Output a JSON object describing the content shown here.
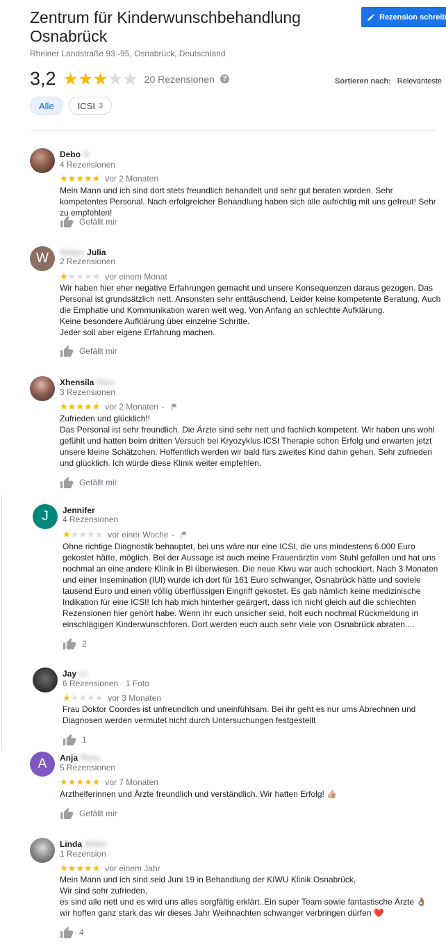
{
  "header": {
    "title": "Zentrum für Kinderwunschbehandlung Osnabrück",
    "address": "Rheiner Landstraße 93 -95, Osnabrück, Deutschland",
    "write_review_label": "Rezension schreiben",
    "rating": "3,2",
    "rating_value": 3.2,
    "review_count": "20 Rezensionen",
    "sort_label": "Sortieren nach:",
    "sort_value": "Relevanteste"
  },
  "filters": [
    {
      "label": "Alle",
      "count": ""
    },
    {
      "label": "ICSI",
      "count": "3"
    }
  ],
  "colors": {
    "accent": "#1a73e8",
    "star": "#fbbc04",
    "avatar_w": "#8d6e63",
    "avatar_j": "#00897b",
    "avatar_a": "#7e57c2"
  },
  "reviews": [
    {
      "name": "Debo",
      "name_blurred": "S",
      "meta": "4 Rezensionen",
      "stars": 5,
      "time": "vor 2 Monaten",
      "text": "Mein Mann und ich sind dort stets freundlich behandelt und sehr gut beraten worden. Sehr kompetentes Personal. Nach erfolgreicher Behandlung haben sich alle aufrichtig mit uns gefreut! Sehr zu empfehlen!",
      "like": "Gefällt mir"
    },
    {
      "name": "Julia",
      "name_blurred": "Weber",
      "initial": "W",
      "meta": "2 Rezensionen",
      "stars": 1,
      "time": "vor einem Monat",
      "text": "Wir haben hier eher negative Erfahrungen gemacht und unsere Konsequenzen daraus gezogen. Das Personal ist grundsätzlich nett. Ansonsten sehr enttäuschend.  Leider keine kompetente Beratung. Auch die Emphatie und Kommunikation waren weit weg. Von Anfang an schlechte Aufklärung.\nKeine besondere Aufklärung über einzelne Schritte.\nJeder soll aber eigene Erfahrung machen.",
      "like": "Gefällt mir"
    },
    {
      "name": "Xhensila",
      "name_blurred": "Peru",
      "meta": "3 Rezensionen",
      "stars": 5,
      "time": "vor 2 Monaten",
      "text": "Zufrieden und glücklich!!\nDas Personal ist sehr freundlich. Die Ärzte sind sehr nett und fachlich kompetent. Wir haben uns wohl gefühlt und hatten beim dritten Versuch bei Kryozyklus ICSI Therapie schon Erfolg und erwarten jetzt unsere kleine Schätzchen. Hoffentlich werden wir bald fürs zweites Kind dahin gehen. Sehr zufrieden und glücklich. Ich würde diese Klinik weiter empfehlen.",
      "like": "Gefällt mir"
    },
    {
      "name": "Jennifer",
      "initial": "J",
      "meta": "4 Rezensionen",
      "stars": 1,
      "time": "vor einer Woche",
      "text": "Ohne richtige Diagnostik behauptet,  bei uns wäre nur eine ICSI, die uns mindestens 6.000 Euro gekostet hätte, möglich. Bei der Aussage ist auch meine Frauenärztin vom Stuhl gefallen und hat uns nochmal an eine andere Klinik in Bl überwiesen. Die neue Kiwu war auch schockiert. Nach 3 Monaten und einer Insemination (IUI) wurde ich dort für 161 Euro schwanger, Osnabrück hätte und soviele tausend Euro und einen völlig überflüssigen Eingriff gekostet. Es gab nämlich  keine medizinische Indikation für eine ICSI! Ich hab mich hinterher geärgert,  dass ich nicht gleich auf die schlechten Rezensionen hier gehört habe. Wenn ihr euch unsicher seid, holt euch nochmal Rückmeldung in einschlägigen Kinderwunschforen. Dort werden euch auch sehr viele von Osnabrück abraten....",
      "like": "2"
    },
    {
      "name": "Jay",
      "name_blurred": "Ci",
      "meta": "6 Rezensionen · 1 Foto",
      "stars": 1,
      "time": "vor 3 Monaten",
      "text": "Frau Doktor Coordes ist unfreundlich und uneinfühlsam. Bei ihr geht es nur ums Abrechnen und Diagnosen werden vermutet nicht durch Untersuchungen festgestellt",
      "like": "1"
    },
    {
      "name": "Anja",
      "name_blurred": "Renz",
      "initial": "A",
      "meta": "5 Rezensionen",
      "stars": 5,
      "time": "vor 7 Monaten",
      "text": "Arzthelferinnen und Ärzte freundlich und verständlich. Wir hatten Erfolg!",
      "emoji": "👍🏼",
      "like": "Gefällt mir"
    },
    {
      "name": "Linda",
      "name_blurred": "Müller",
      "meta": "1 Rezension",
      "stars": 5,
      "time": "vor einem Jahr",
      "text": "Mein Mann und ich sind seid Juni 19 in Behandlung der KIWU Klinik Osnabrück,\nWir sind sehr zufrieden,\nes sind alle nett und es wird uns alles sorgfältig erklärt..Ein super Team sowie fantastische Ärzte 👌🏽\n wir hoffen ganz stark das wir dieses Jahr Weihnachten schwanger verbringen dürfen ❤️",
      "like": "4"
    }
  ]
}
